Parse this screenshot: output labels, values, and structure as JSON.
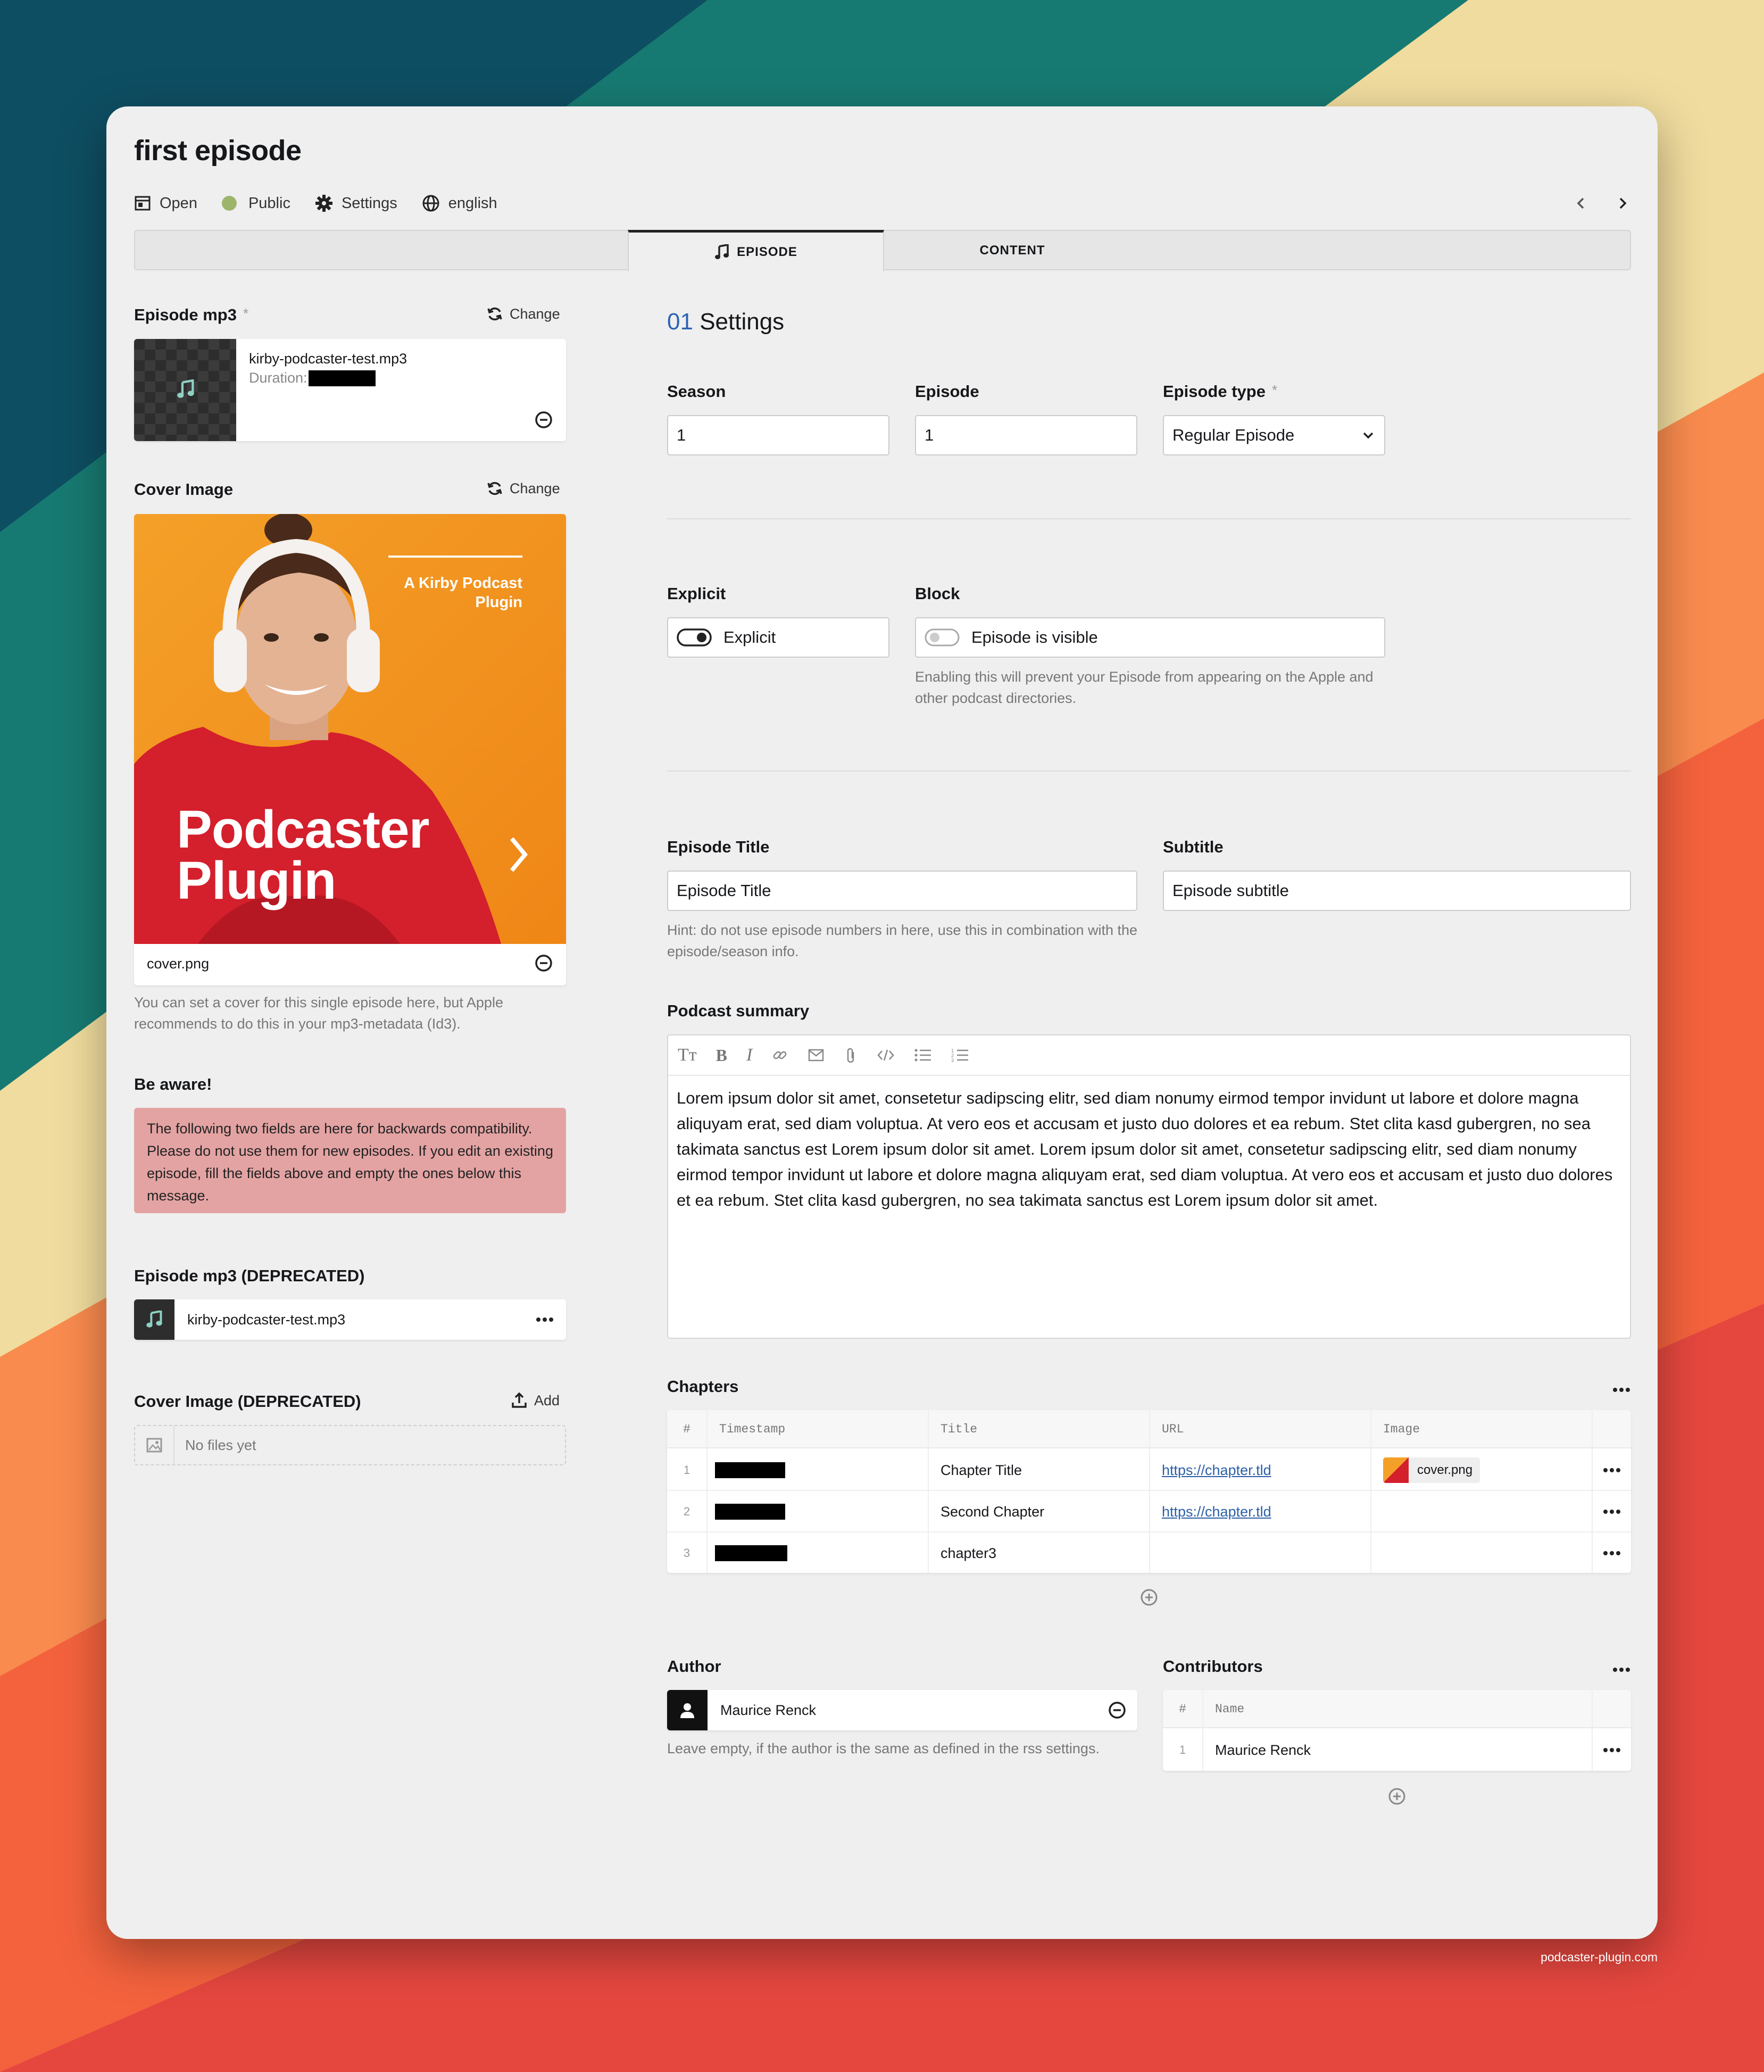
{
  "page": {
    "title": "first episode",
    "footer": "podcaster-plugin.com"
  },
  "meta": {
    "open": "Open",
    "status": "Public",
    "settings": "Settings",
    "language": "english"
  },
  "tabs": [
    "EPISODE",
    "CONTENT"
  ],
  "left": {
    "mp3": {
      "label": "Episode mp3",
      "required": "*",
      "change": "Change",
      "filename": "kirby-podcaster-test.mp3",
      "duration_label": "Duration:"
    },
    "cover": {
      "label": "Cover Image",
      "change": "Change",
      "filename": "cover.png",
      "help": "You can set a cover for this single episode here, but Apple recommends to do this in your mp3-metadata (Id3).",
      "art": {
        "top": "A Kirby Podcast Plugin",
        "line1": "Podcaster",
        "line2": "Plugin"
      }
    },
    "aware": {
      "label": "Be aware!",
      "text": "The following two fields are here for backwards compatibility. Please do not use them for new episodes. If you edit an existing episode, fill the fields above and empty the ones below this message."
    },
    "mp3_deprecated": {
      "label": "Episode mp3 (DEPRECATED)",
      "filename": "kirby-podcaster-test.mp3"
    },
    "cover_deprecated": {
      "label": "Cover Image (DEPRECATED)",
      "add": "Add",
      "empty": "No files yet"
    }
  },
  "right": {
    "section": {
      "number": "01",
      "title": "Settings"
    },
    "season": {
      "label": "Season",
      "value": "1"
    },
    "episode": {
      "label": "Episode",
      "value": "1"
    },
    "episode_type": {
      "label": "Episode type",
      "required": "*",
      "value": "Regular Episode"
    },
    "explicit": {
      "label": "Explicit",
      "toggle_text": "Explicit",
      "on": true
    },
    "block": {
      "label": "Block",
      "toggle_text": "Episode is visible",
      "on": false,
      "help": "Enabling this will prevent your Episode from appearing on the Apple and other podcast directories."
    },
    "episode_title": {
      "label": "Episode Title",
      "value": "Episode Title",
      "help": "Hint: do not use episode numbers in here, use this in combination with the episode/season info."
    },
    "subtitle": {
      "label": "Subtitle",
      "value": "Episode subtitle"
    },
    "summary": {
      "label": "Podcast summary",
      "text": "Lorem ipsum dolor sit amet, consetetur sadipscing elitr, sed diam nonumy eirmod tempor invidunt ut labore et dolore magna aliquyam erat, sed diam voluptua. At vero eos et accusam et justo duo dolores et ea rebum. Stet clita kasd gubergren, no sea takimata sanctus est Lorem ipsum dolor sit amet. Lorem ipsum dolor sit amet, consetetur sadipscing elitr, sed diam nonumy eirmod tempor invidunt ut labore et dolore magna aliquyam erat, sed diam voluptua. At vero eos et accusam et justo duo dolores et ea rebum. Stet clita kasd gubergren, no sea takimata sanctus est Lorem ipsum dolor sit amet."
    },
    "chapters": {
      "label": "Chapters",
      "columns": [
        "#",
        "Timestamp",
        "Title",
        "URL",
        "Image"
      ],
      "rows": [
        {
          "n": "1",
          "title": "Chapter Title",
          "url": "https://chapter.tld",
          "image": "cover.png"
        },
        {
          "n": "2",
          "title": "Second Chapter",
          "url": "https://chapter.tld",
          "image": ""
        },
        {
          "n": "3",
          "title": "chapter3",
          "url": "",
          "image": ""
        }
      ]
    },
    "author": {
      "label": "Author",
      "name": "Maurice Renck",
      "help": "Leave empty, if the author is the same as defined in the rss settings."
    },
    "contributors": {
      "label": "Contributors",
      "columns": [
        "#",
        "Name"
      ],
      "rows": [
        {
          "n": "1",
          "name": "Maurice Renck"
        }
      ]
    }
  }
}
